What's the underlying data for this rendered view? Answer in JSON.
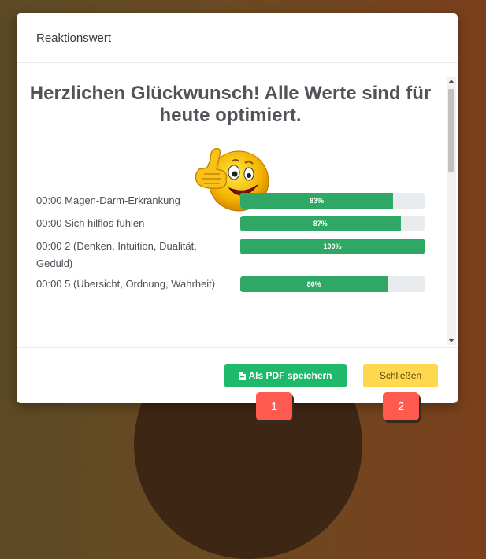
{
  "modal": {
    "title": "Reaktionswert",
    "headline": "Herzlichen Glückwunsch! Alle Werte sind für heute optimiert.",
    "entries": [
      {
        "label": "00:00 Magen-Darm-Erkrankung",
        "value": 83,
        "value_text": "83%"
      },
      {
        "label": "00:00 Sich hilflos fühlen",
        "value": 87,
        "value_text": "87%"
      },
      {
        "label": "00:00 2 (Denken, Intuition, Dualität, Geduld)",
        "value": 100,
        "value_text": "100%"
      },
      {
        "label": "00:00 5 (Übersicht, Ordnung, Wahrheit)",
        "value": 80,
        "value_text": "80%"
      }
    ],
    "buttons": {
      "save_pdf": "Als PDF speichern",
      "close": "Schließen"
    }
  },
  "markers": [
    "1",
    "2"
  ],
  "colors": {
    "bar_fill": "#2fa866",
    "pdf_button": "#1fb96b",
    "close_button": "#ffd84d",
    "marker": "#ff5a4f"
  },
  "icons": {
    "emoji": "thumbs-up-smiley-icon",
    "pdf": "file-pdf-icon"
  }
}
